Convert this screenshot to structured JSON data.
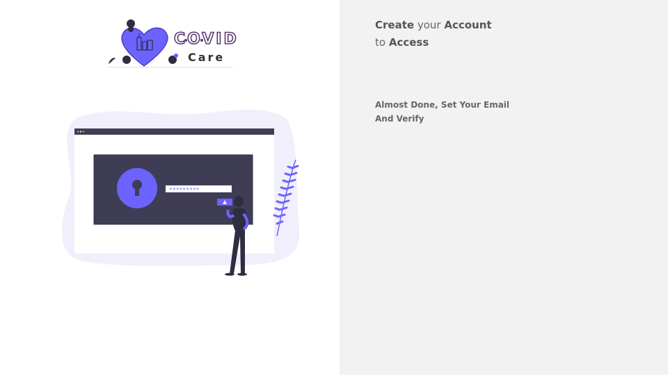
{
  "logo": {
    "line1": "COVID",
    "line2": "Care"
  },
  "illustration": {
    "password_mask": "*********"
  },
  "headline": {
    "word1": "Create",
    "word2": "your",
    "word3": "Account",
    "word4": "to",
    "word5": "Access"
  },
  "subtext": {
    "line1": "Almost Done, Set Your Email",
    "line2": "And Verify"
  },
  "colors": {
    "accent": "#6c63ff",
    "dark_panel": "#3f3d56",
    "blob": "#f0effb",
    "right_bg": "#f2f2f2"
  }
}
